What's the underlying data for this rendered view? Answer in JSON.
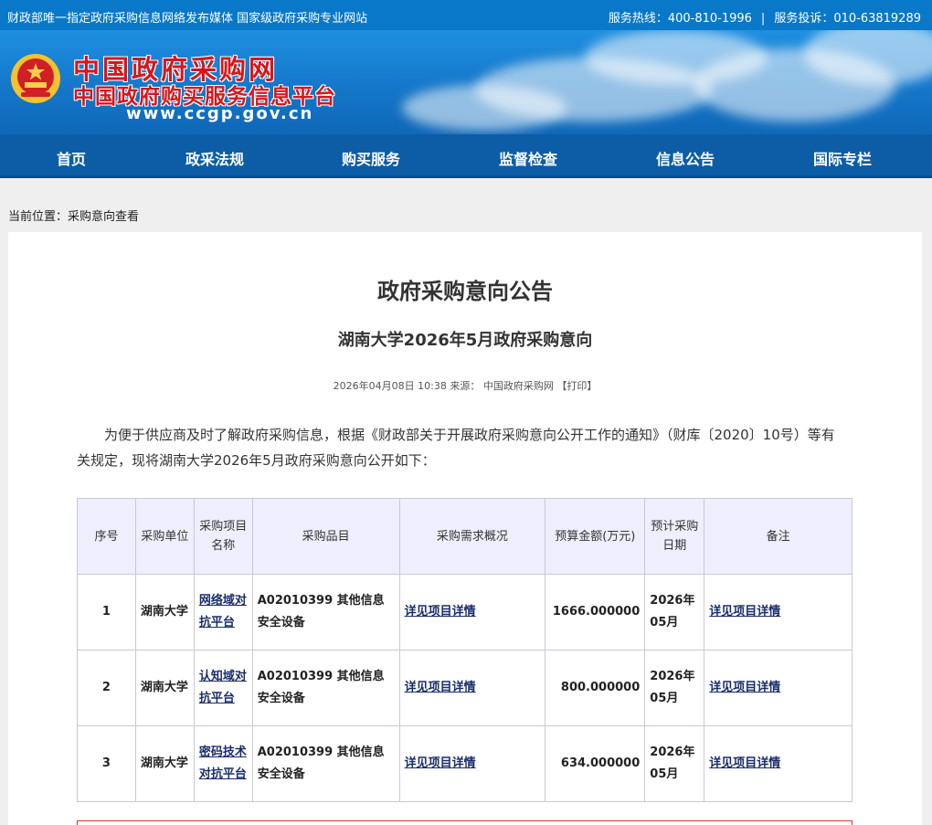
{
  "topbar": {
    "left_text": "财政部唯一指定政府采购信息网络发布媒体 国家级政府采购专业网站",
    "hotline": "服务热线：400-810-1996",
    "separator": "|",
    "complaint": "服务投诉：010-63819289"
  },
  "banner": {
    "title": "中国政府采购网",
    "subtitle": "中国政府购买服务信息平台",
    "url": "www.ccgp.gov.cn"
  },
  "nav": [
    "首页",
    "政采法规",
    "购买服务",
    "监督检查",
    "信息公告",
    "国际专栏"
  ],
  "breadcrumb": "当前位置：采购意向查看",
  "article": {
    "heading": "政府采购意向公告",
    "subheading": "湖南大学2026年5月政府采购意向",
    "meta": "2026年04月08日 10:38 来源： 中国政府采购网 【打印】",
    "intro": "为便于供应商及时了解政府采购信息，根据《财政部关于开展政府采购意向公开工作的通知》（财库〔2020〕10号）等有关规定，现将湖南大学2026年5月政府采购意向公开如下："
  },
  "table": {
    "headers": [
      "序号",
      "采购单位",
      "采购项目名称",
      "采购品目",
      "采购需求概况",
      "预算金额(万元)",
      "预计采购日期",
      "备注"
    ],
    "rows": [
      {
        "no": "1",
        "unit": "湖南大学",
        "project": "网络域对抗平台",
        "category": "A02010399 其他信息安全设备",
        "demand": "详见项目详情",
        "budget": "1666.000000",
        "date": "2026年05月",
        "note": "详见项目详情"
      },
      {
        "no": "2",
        "unit": "湖南大学",
        "project": "认知域对抗平台",
        "category": "A02010399 其他信息安全设备",
        "demand": "详见项目详情",
        "budget": "800.000000",
        "date": "2026年05月",
        "note": "详见项目详情"
      },
      {
        "no": "3",
        "unit": "湖南大学",
        "project": "密码技术对抗平台",
        "category": "A02010399 其他信息安全设备",
        "demand": "详见项目详情",
        "budget": "634.000000",
        "date": "2026年05月",
        "note": "详见项目详情"
      }
    ]
  },
  "colors": {
    "topbar": "#0a78c8",
    "nav": "#0c5da6",
    "title_red": "#d5171c",
    "table_header_bg": "#eeeefc",
    "link": "#1a2d6b"
  },
  "icons": {
    "logo": "national-emblem-icon"
  }
}
